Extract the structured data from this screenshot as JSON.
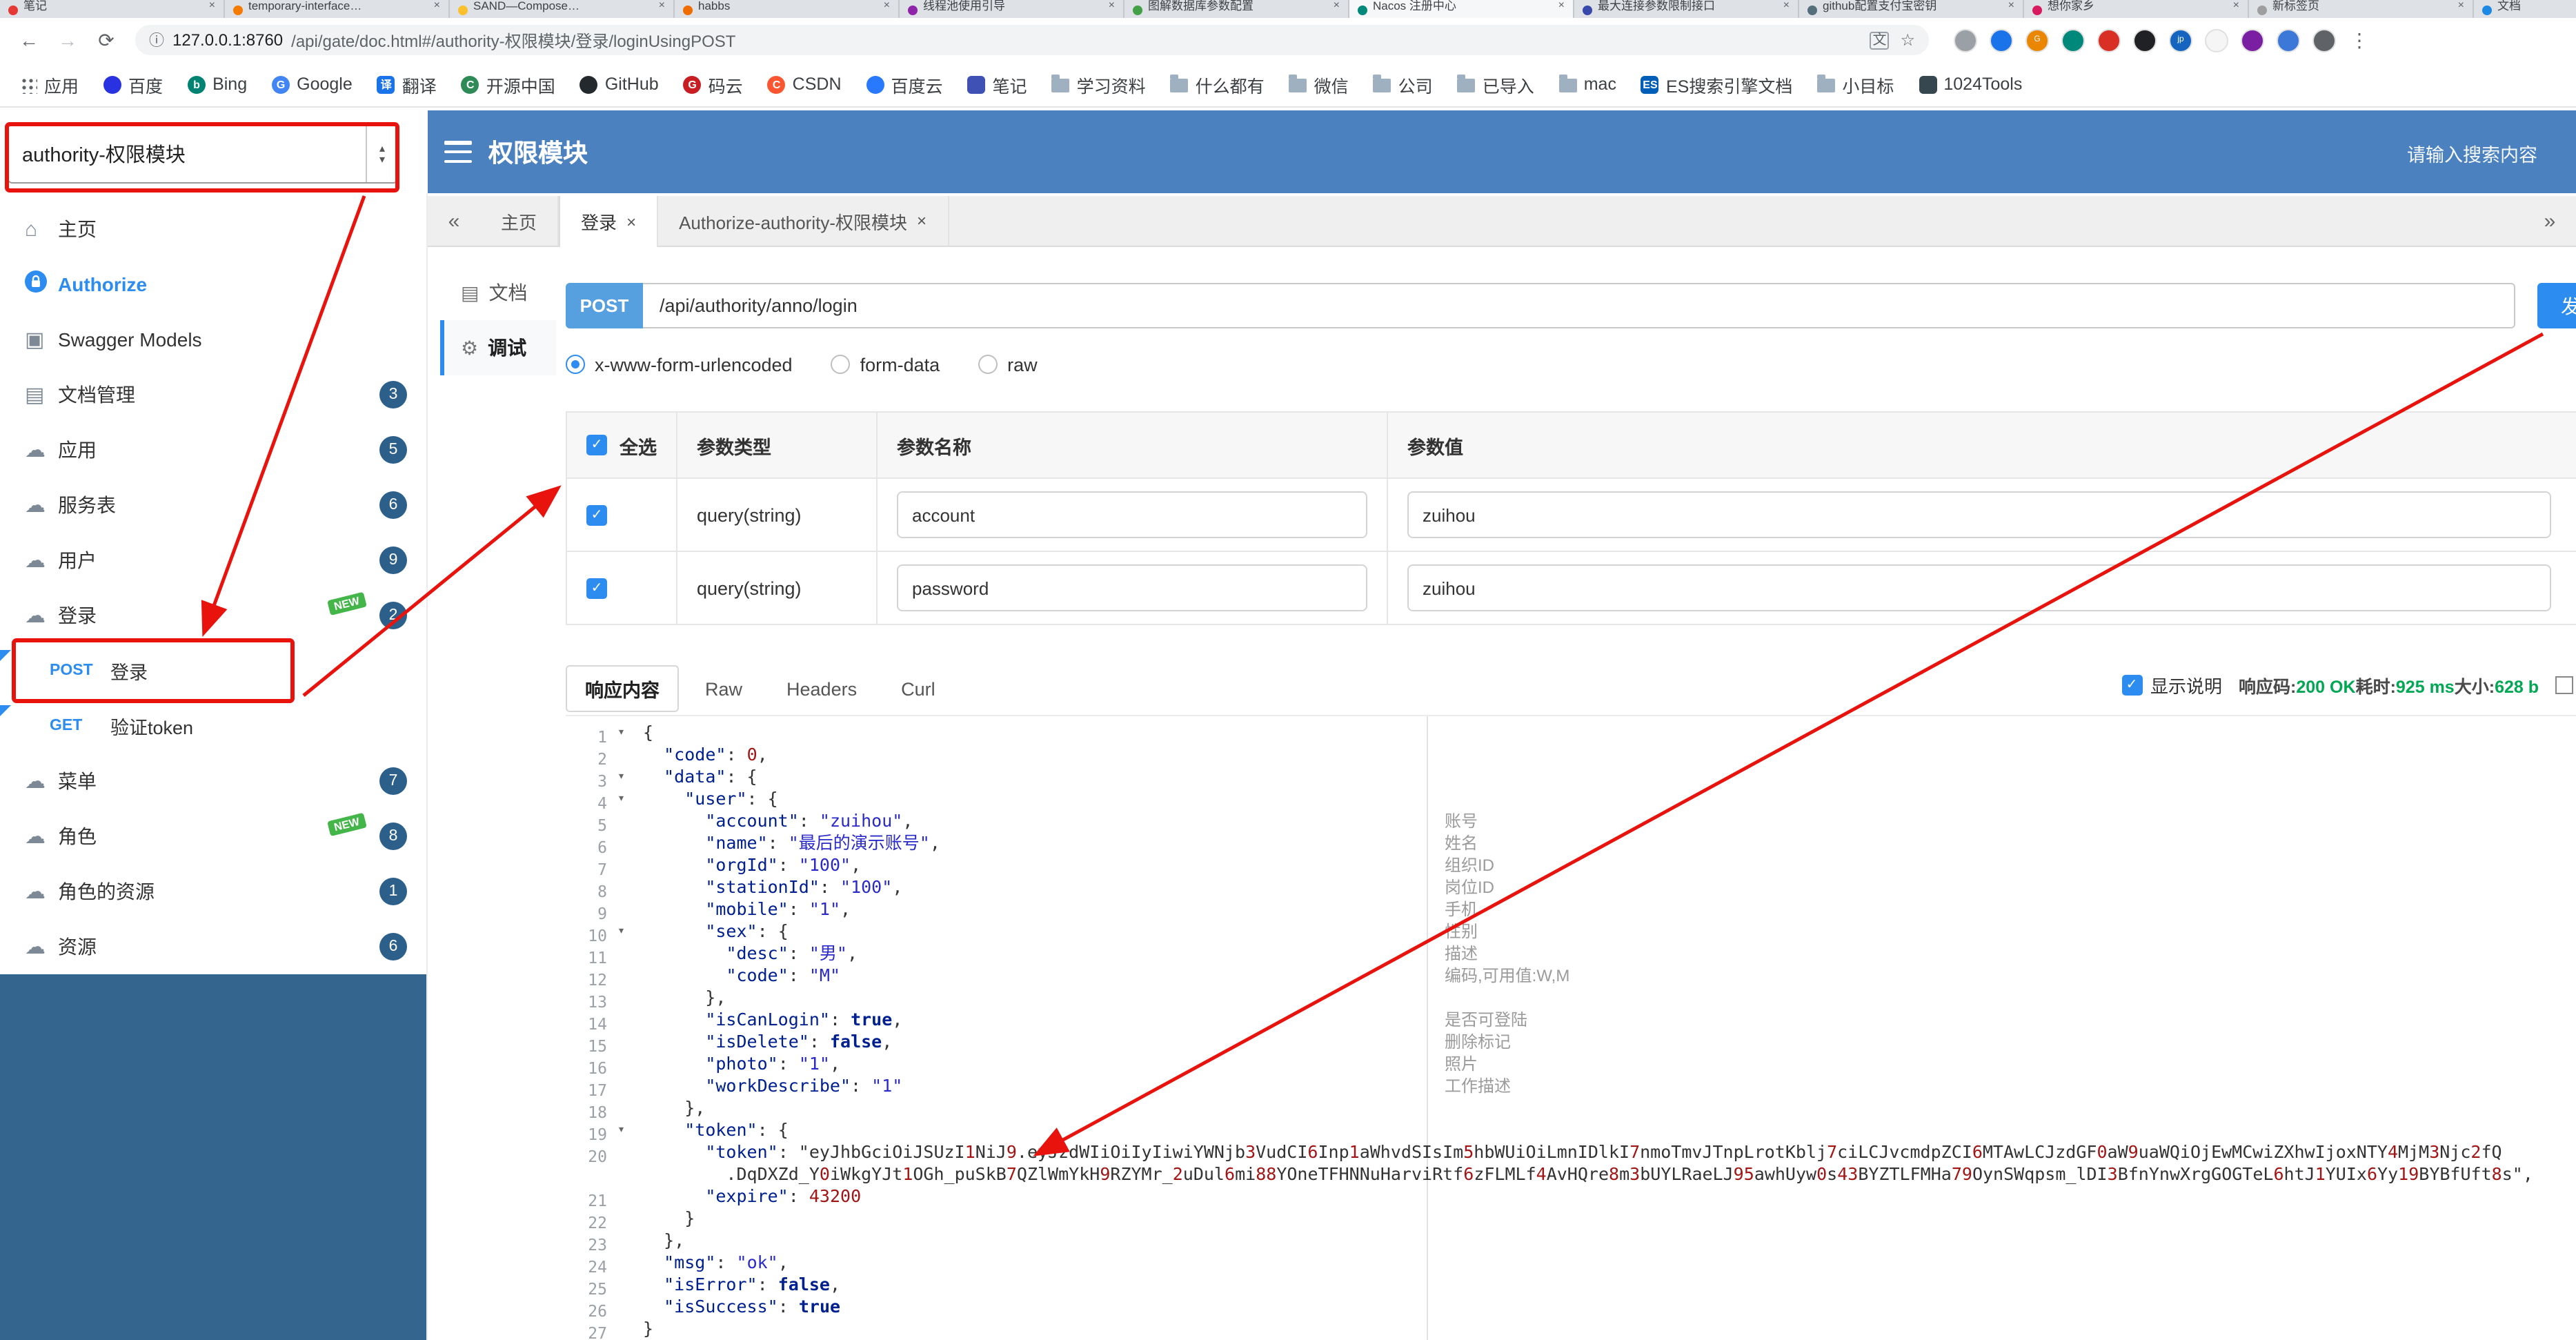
{
  "colors": {
    "header_blue": "#4b81bf",
    "accent_blue": "#2d8cf0",
    "method_chip_blue": "#56a0e0",
    "success_green": "#00a854",
    "annotation_red": "#e8130c",
    "badge_navy": "#2d5f8b",
    "new_tag_green": "#44b549",
    "sidebar_fill_blue": "#34658f"
  },
  "icons": {
    "close": "×",
    "collapse": "«",
    "expand": "»",
    "back": "←",
    "forward": "→",
    "reload": "⟳",
    "info": "ⓘ",
    "star": "☆",
    "menu_dots": "⋮",
    "translate": "文",
    "house": "⌂",
    "cloud": "☁",
    "doc": "▤",
    "models": "▣",
    "gear": "⚙",
    "check": "✓",
    "up": "▴",
    "down": "▾"
  },
  "browser": {
    "tabs": [
      {
        "title": "笔记",
        "color": "#e53935"
      },
      {
        "title": "temporary-interface…",
        "color": "#f57c00"
      },
      {
        "title": "SAND—Compose…",
        "color": "#fbc02d"
      },
      {
        "title": "habbs",
        "color": "#ef6c00"
      },
      {
        "title": "线程池使用引导",
        "color": "#8e24aa"
      },
      {
        "title": "图解数据库参数配置",
        "color": "#43a047"
      },
      {
        "title": "Nacos 注册中心",
        "color": "#00897b"
      },
      {
        "title": "最大连接参数限制接口",
        "color": "#3949ab"
      },
      {
        "title": "github配置支付宝密钥",
        "color": "#546e7a"
      },
      {
        "title": "想你家乡",
        "color": "#d81b60"
      },
      {
        "title": "新标签页",
        "color": "#9e9e9e"
      },
      {
        "title": "文档",
        "color": "#1e88e5"
      }
    ],
    "toolbar": {
      "url_host": "127.0.0.1:8760",
      "url_path": "/api/gate/doc.html#/authority-权限模块/登录/loginUsingPOST"
    },
    "extensions": [
      {
        "color": "#9aa0a6",
        "glyph": ""
      },
      {
        "color": "#1a73e8",
        "glyph": ""
      },
      {
        "color": "#ea8600",
        "glyph": "G"
      },
      {
        "color": "#00897b",
        "glyph": ""
      },
      {
        "color": "#d93025",
        "glyph": ""
      },
      {
        "color": "#202124",
        "glyph": ""
      },
      {
        "color": "#1565c0",
        "glyph": "jp"
      },
      {
        "color": "#f5f5f5",
        "glyph": ""
      },
      {
        "color": "#7b1fa2",
        "glyph": ""
      },
      {
        "color": "#3c78d8",
        "glyph": ""
      },
      {
        "color": "#5f6368",
        "glyph": ""
      }
    ],
    "bookmarks": [
      {
        "label": "应用",
        "icon": "grid"
      },
      {
        "label": "百度",
        "icon": "circle",
        "color": "#2932e1"
      },
      {
        "label": "Bing",
        "icon": "circle",
        "color": "#008373",
        "glyph": "b"
      },
      {
        "label": "Google",
        "icon": "circle",
        "color": "#4285f4",
        "glyph": "G"
      },
      {
        "label": "翻译",
        "icon": "square",
        "color": "#1a73e8",
        "glyph": "译"
      },
      {
        "label": "开源中国",
        "icon": "circle",
        "color": "#2e8b57",
        "glyph": "C"
      },
      {
        "label": "GitHub",
        "icon": "circle",
        "color": "#24292e"
      },
      {
        "label": "码云",
        "icon": "circle",
        "color": "#c71d23",
        "glyph": "G"
      },
      {
        "label": "CSDN",
        "icon": "circle",
        "color": "#fc5531",
        "glyph": "C"
      },
      {
        "label": "百度云",
        "icon": "circle",
        "color": "#2979ff"
      },
      {
        "label": "笔记",
        "icon": "square",
        "color": "#3f51b5"
      },
      {
        "label": "学习资料",
        "icon": "folder"
      },
      {
        "label": "什么都有",
        "icon": "folder"
      },
      {
        "label": "微信",
        "icon": "folder"
      },
      {
        "label": "公司",
        "icon": "folder"
      },
      {
        "label": "已导入",
        "icon": "folder"
      },
      {
        "label": "mac",
        "icon": "folder"
      },
      {
        "label": "ES搜索引擎文档",
        "icon": "square",
        "color": "#005eb8",
        "glyph": "ES"
      },
      {
        "label": "小目标",
        "icon": "folder"
      },
      {
        "label": "1024Tools",
        "icon": "square",
        "color": "#37474f"
      }
    ]
  },
  "header": {
    "group_selector": "authority-权限模块",
    "title": "权限模块",
    "search_placeholder": "请输入搜索内容"
  },
  "sidebar": {
    "new_label": "NEW",
    "items": [
      {
        "label": "主页"
      },
      {
        "label": "Authorize"
      },
      {
        "label": "Swagger Models"
      },
      {
        "label": "文档管理",
        "badge": "3"
      },
      {
        "label": "应用",
        "badge": "5"
      },
      {
        "label": "服务表",
        "badge": "6"
      },
      {
        "label": "用户",
        "badge": "9"
      },
      {
        "label": "登录",
        "badge": "2",
        "is_new": true
      },
      {
        "method": "POST",
        "label": "登录"
      },
      {
        "method": "GET",
        "label": "验证token"
      },
      {
        "label": "菜单",
        "badge": "7"
      },
      {
        "label": "角色",
        "badge": "8",
        "is_new": true
      },
      {
        "label": "角色的资源",
        "badge": "1"
      },
      {
        "label": "资源",
        "badge": "6"
      }
    ]
  },
  "workspace_tabs": {
    "items": [
      {
        "label": "主页"
      },
      {
        "label": "登录"
      },
      {
        "label": "Authorize-authority-权限模块"
      }
    ]
  },
  "doc_tabs": {
    "doc": "文档",
    "debug": "调试"
  },
  "request": {
    "method": "POST",
    "url": "/api/authority/anno/login",
    "send_label": "发送",
    "content_types": [
      "x-www-form-urlencoded",
      "form-data",
      "raw"
    ],
    "selected_content_type": "x-www-form-urlencoded",
    "params_table": {
      "headers": [
        "全选",
        "参数类型",
        "参数名称",
        "参数值"
      ],
      "rows": [
        {
          "checked": true,
          "type": "query(string)",
          "name": "account",
          "value": "zuihou"
        },
        {
          "checked": true,
          "type": "query(string)",
          "name": "password",
          "value": "zuihou"
        }
      ]
    }
  },
  "response": {
    "tabs": [
      "响应内容",
      "Raw",
      "Headers",
      "Curl"
    ],
    "active_tab": "响应内容",
    "show_desc_label": "显示说明",
    "meta": {
      "code_label": "响应码:",
      "code": "200 OK",
      "time_label": "耗时:",
      "time": "925 ms",
      "size_label": "大小:",
      "size": "628 b"
    },
    "code_lines": [
      {
        "n": "1",
        "fold": true,
        "text": "{"
      },
      {
        "n": "2",
        "text": "  \"code\": 0,"
      },
      {
        "n": "3",
        "fold": true,
        "text": "  \"data\": {"
      },
      {
        "n": "4",
        "fold": true,
        "text": "    \"user\": {"
      },
      {
        "n": "5",
        "text": "      \"account\": \"zuihou\",",
        "note": "账号"
      },
      {
        "n": "6",
        "text": "      \"name\": \"最后的演示账号\",",
        "note": "姓名"
      },
      {
        "n": "7",
        "text": "      \"orgId\": \"100\",",
        "note": "组织ID"
      },
      {
        "n": "8",
        "text": "      \"stationId\": \"100\",",
        "note": "岗位ID"
      },
      {
        "n": "9",
        "text": "      \"mobile\": \"1\",",
        "note": "手机"
      },
      {
        "n": "10",
        "fold": true,
        "text": "      \"sex\": {",
        "note": "性别"
      },
      {
        "n": "11",
        "text": "        \"desc\": \"男\",",
        "note": "描述"
      },
      {
        "n": "12",
        "text": "        \"code\": \"M\"",
        "note": "编码,可用值:W,M"
      },
      {
        "n": "13",
        "text": "      },"
      },
      {
        "n": "14",
        "text": "      \"isCanLogin\": true,",
        "note": "是否可登陆"
      },
      {
        "n": "15",
        "text": "      \"isDelete\": false,",
        "note": "删除标记"
      },
      {
        "n": "16",
        "text": "      \"photo\": \"1\",",
        "note": "照片"
      },
      {
        "n": "17",
        "text": "      \"workDescribe\": \"1\"",
        "note": "工作描述"
      },
      {
        "n": "18",
        "text": "    },"
      },
      {
        "n": "19",
        "fold": true,
        "text": "    \"token\": {"
      },
      {
        "n": "20",
        "text": "      \"token\": \"eyJhbGciOiJSUzI1NiJ9.eyJzdWIiOiIyIiwiYWNjb3VudCI6Inp1aWhvdSIsIm5hbWUiOiLmnIDlkI7nmoTmvJTnpLrotKblj7ciLCJvcmdpZCI6MTAwLCJzdGF0aW9uaWQiOjEwMCwiZXhwIjoxNTY4MjM3Njc2fQ"
      },
      {
        "n": "",
        "text": "        .DqDXZd_Y0iWkgYJt1OGh_puSkB7QZlWmYkH9RZYMr_2uDul6mi88YOneTFHNNuHarviRtf6zFLMLf4AvHQre8m3bUYLRaeLJ95awhUyw0s43BYZTLFMHa79OynSWqpsm_lDI3BfnYnwXrgGOGTeL6htJ1YUIx6Yy19BYBfUft8s\","
      },
      {
        "n": "21",
        "text": "      \"expire\": 43200"
      },
      {
        "n": "22",
        "text": "    }"
      },
      {
        "n": "23",
        "text": "  },"
      },
      {
        "n": "24",
        "text": "  \"msg\": \"ok\","
      },
      {
        "n": "25",
        "text": "  \"isError\": false,"
      },
      {
        "n": "26",
        "text": "  \"isSuccess\": true"
      },
      {
        "n": "27",
        "text": "}"
      }
    ]
  }
}
